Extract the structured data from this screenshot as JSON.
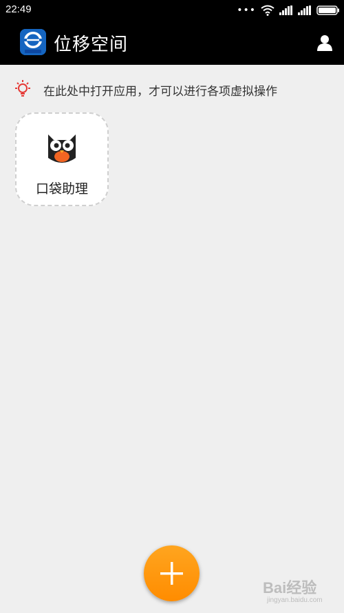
{
  "status_bar": {
    "time": "22:49",
    "icons": [
      "more-dots-icon",
      "wifi-icon",
      "signal-icon",
      "signal-icon",
      "battery-icon"
    ]
  },
  "app_bar": {
    "title": "位移空间",
    "logo_icon": "vmos-logo-icon",
    "user_icon": "user-icon"
  },
  "hint": {
    "icon": "lightbulb-icon",
    "text": "在此处中打开应用，才可以进行各项虚拟操作",
    "icon_color": "#e53935"
  },
  "apps": [
    {
      "name": "口袋助理",
      "icon": "owl-app-icon"
    }
  ],
  "fab": {
    "icon": "plus-icon",
    "color": "#ff9800"
  },
  "watermark": {
    "text": "Bai经验",
    "sub": "jingyan.baidu.com"
  },
  "colors": {
    "accent": "#ff9800",
    "bar": "#000000",
    "background": "#efefef"
  }
}
